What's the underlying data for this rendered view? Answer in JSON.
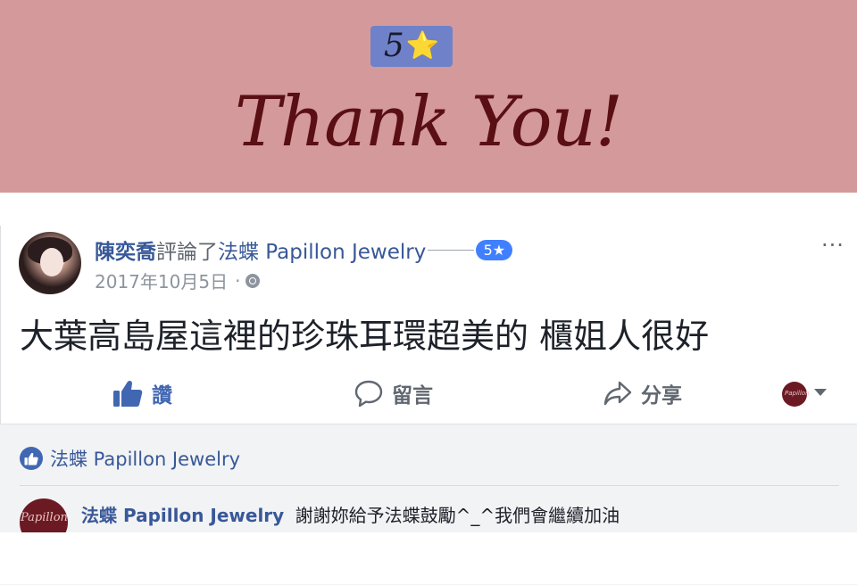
{
  "banner": {
    "rating": "5",
    "rating_star": "⭐",
    "headline": "Thank You!"
  },
  "post": {
    "author": "陳奕喬",
    "verb": "評論了",
    "page_name": "法蝶 Papillon Jewelry",
    "rating_pill": "5★",
    "date": "2017年10月5日",
    "separator": "·",
    "more": "···",
    "text": "大葉高島屋這裡的珍珠耳環超美的 櫃姐人很好"
  },
  "actions": {
    "like": "讚",
    "comment": "留言",
    "share": "分享",
    "page_avatar_text": "Papillon"
  },
  "reactions": {
    "like_name": "法蝶 Papillon Jewelry"
  },
  "reply": {
    "avatar_text": "Papillon",
    "name": "法蝶 Papillon Jewelry",
    "text": "謝謝妳給予法蝶鼓勵^_^我們會繼續加油"
  },
  "colors": {
    "banner": "#d4999a",
    "badge": "#6f82c9",
    "link_blue": "#385898",
    "like_blue": "#4267b2"
  }
}
